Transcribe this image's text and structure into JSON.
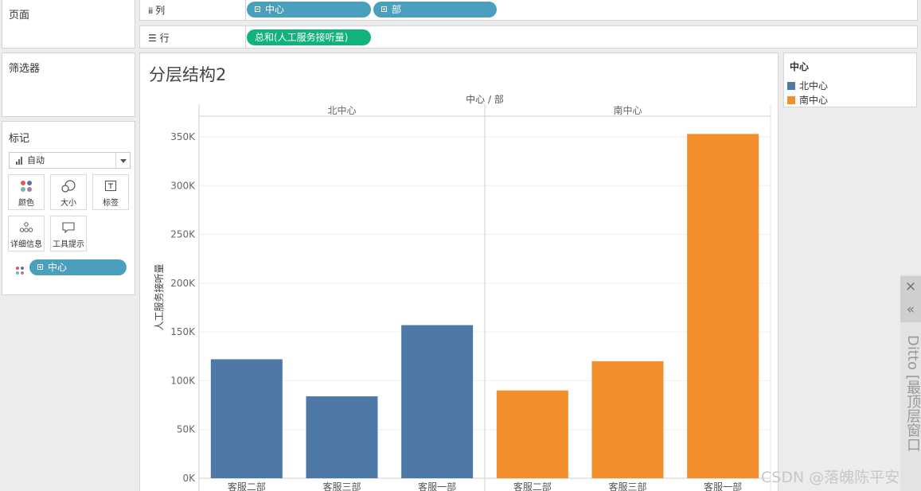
{
  "pages_panel": {
    "title": "页面"
  },
  "filters_panel": {
    "title": "筛选器"
  },
  "marks_panel": {
    "title": "标记",
    "mark_type": "自动",
    "buttons": [
      "颜色",
      "大小",
      "标签",
      "详细信息",
      "工具提示"
    ],
    "color_pill": "中心"
  },
  "columns_shelf": {
    "label": "列",
    "pills": [
      "中心",
      "部"
    ]
  },
  "rows_shelf": {
    "label": "行",
    "pill": "总和(人工服务接听量)"
  },
  "legend": {
    "title": "中心",
    "items": [
      {
        "label": "北中心",
        "color": "#4e79a7"
      },
      {
        "label": "南中心",
        "color": "#f28e2b"
      }
    ]
  },
  "chart_data": {
    "type": "bar",
    "title": "分层结构2",
    "header": "中心 / 部",
    "ylabel": "人工服务接听量",
    "ylim": [
      0,
      370000
    ],
    "yticks": [
      0,
      50000,
      100000,
      150000,
      200000,
      250000,
      300000,
      350000
    ],
    "ytick_labels": [
      "0K",
      "50K",
      "100K",
      "150K",
      "200K",
      "250K",
      "300K",
      "350K"
    ],
    "panes": [
      {
        "name": "北中心",
        "color": "#4e79a7",
        "categories": [
          "客服二部",
          "客服三部",
          "客服一部"
        ],
        "values": [
          122000,
          84000,
          157000
        ]
      },
      {
        "name": "南中心",
        "color": "#f28e2b",
        "categories": [
          "客服二部",
          "客服三部",
          "客服一部"
        ],
        "values": [
          90000,
          120000,
          353000
        ]
      }
    ]
  },
  "ditto": {
    "close_glyph": "✕",
    "collapse_glyph": "«",
    "text": "Ditto [最顶层窗口"
  },
  "watermark": "CSDN @落魄陈平安"
}
